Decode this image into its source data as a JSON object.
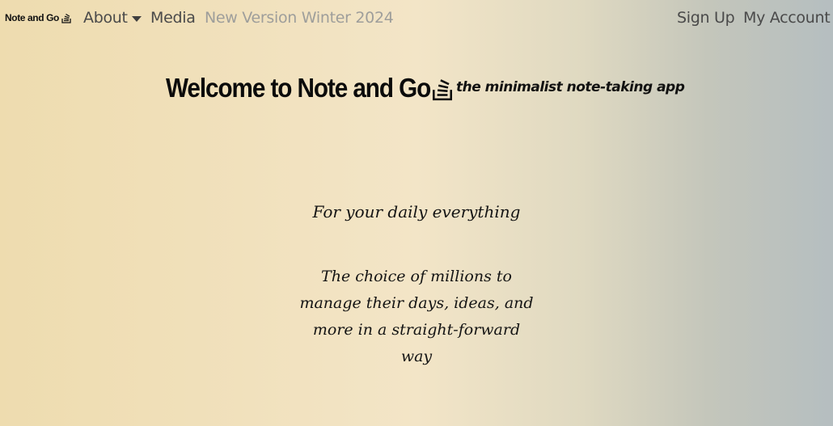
{
  "navbar": {
    "brand": "Note and Go",
    "brand_icon": "stack-icon",
    "about_label": "About",
    "media_label": "Media",
    "version_label": "New Version Winter 2024",
    "signup_label": "Sign Up",
    "account_label": "My Account"
  },
  "hero": {
    "title": "Welcome to Note and Go",
    "icon": "stack-icon",
    "tagline": "the minimalist note-taking app",
    "subtitle": "For your daily everything",
    "blurb": "The choice of millions to manage their days, ideas, and more in a straight-forward way"
  },
  "colors": {
    "gradient_left": "#eedcaf",
    "gradient_mid": "#f3e5c7",
    "gradient_right": "#b5bec0",
    "nav_text": "#4a4a4a",
    "nav_muted": "#9e9e9b"
  }
}
